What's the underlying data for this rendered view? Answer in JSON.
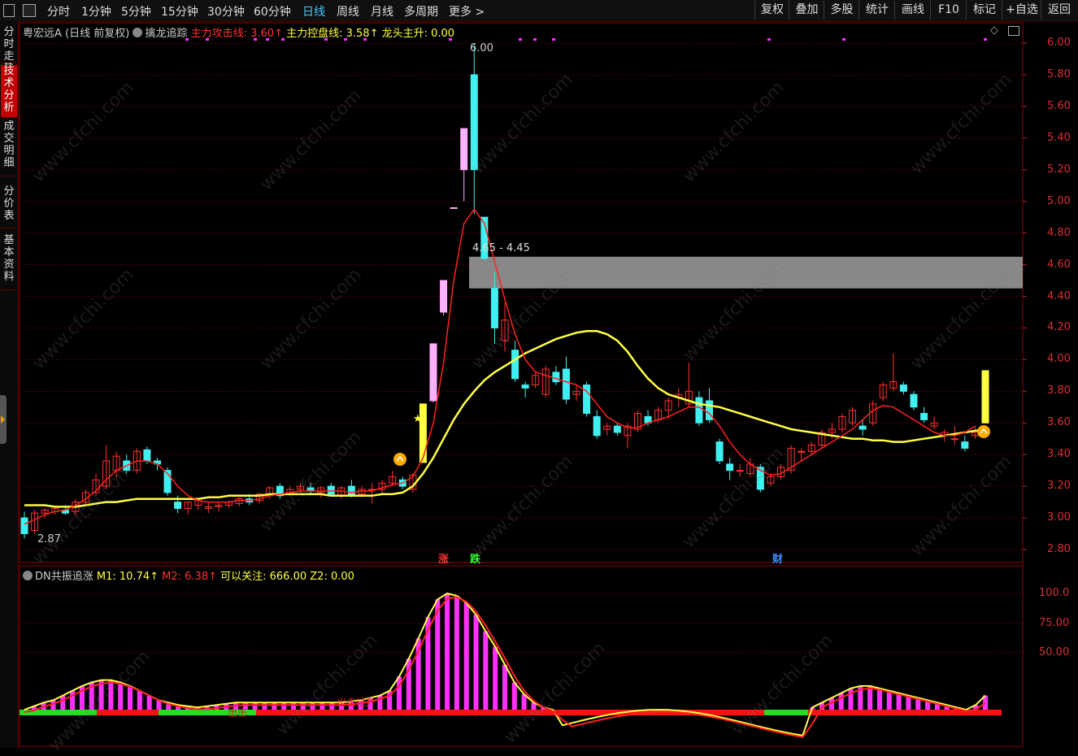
{
  "toolbar": {
    "periods": [
      "分时",
      "1分钟",
      "5分钟",
      "15分钟",
      "30分钟",
      "60分钟",
      "日线",
      "周线",
      "月线",
      "多周期",
      "更多 >"
    ],
    "active_period": "日线",
    "right_buttons": [
      "复权",
      "叠加",
      "多股",
      "统计",
      "画线",
      "F10",
      "标记",
      "+自选",
      "返回"
    ]
  },
  "side_tabs": [
    "分时走势",
    "技术分析",
    "成交明细",
    "分价表",
    "基本资料"
  ],
  "active_side_tab": "技术分析",
  "main_header": {
    "stock": "粤宏远A",
    "mode": "(日线 前复权)",
    "indicator": "擒龙追踪",
    "l1": "主力攻击线: 3.60↑",
    "l2": "主力控盘线: 3.58↑",
    "l3": "龙头主升: 0.00"
  },
  "sub_header": {
    "indicator": "DN共振追涨",
    "m1": "M1: 10.74↑",
    "m2": "M2: 6.38↑",
    "focus": "可以关注: 666.00",
    "z2": "Z2: 0.00"
  },
  "price_axis": [
    "6.00",
    "5.80",
    "5.60",
    "5.40",
    "5.20",
    "5.00",
    "4.80",
    "4.60",
    "4.40",
    "4.20",
    "4.00",
    "3.80",
    "3.60",
    "3.40",
    "3.20",
    "3.00",
    "2.80"
  ],
  "sub_axis": [
    "100.0",
    "75.00",
    "50.00"
  ],
  "annotations": {
    "high": "6.00",
    "low": "2.87",
    "gap": "4.65 - 4.45",
    "tag_up": "涨",
    "tag_down": "跌",
    "tag_fin": "财",
    "sub_text1": "出击",
    "sub_text2": "出击拉升"
  },
  "watermark": "www.cfchi.com",
  "colors": {
    "up": "#ff3030",
    "down": "#40f0f0",
    "axis": "#d83030",
    "ma_yellow": "#ffff40",
    "pink": "#ff30ff",
    "gap_box": "#a0a0a0"
  },
  "chart_data": {
    "type": "candlestick",
    "ylim": [
      2.78,
      6.04
    ],
    "candles": [
      {
        "o": 3.0,
        "h": 3.04,
        "l": 2.87,
        "c": 2.9
      },
      {
        "o": 2.92,
        "h": 3.05,
        "l": 2.9,
        "c": 3.03
      },
      {
        "o": 3.03,
        "h": 3.06,
        "l": 3.0,
        "c": 3.05
      },
      {
        "o": 3.04,
        "h": 3.07,
        "l": 3.02,
        "c": 3.06
      },
      {
        "o": 3.05,
        "h": 3.08,
        "l": 3.02,
        "c": 3.03
      },
      {
        "o": 3.04,
        "h": 3.12,
        "l": 3.02,
        "c": 3.1
      },
      {
        "o": 3.1,
        "h": 3.18,
        "l": 3.08,
        "c": 3.16
      },
      {
        "o": 3.16,
        "h": 3.28,
        "l": 3.14,
        "c": 3.24
      },
      {
        "o": 3.2,
        "h": 3.46,
        "l": 3.18,
        "c": 3.36
      },
      {
        "o": 3.3,
        "h": 3.42,
        "l": 3.25,
        "c": 3.39
      },
      {
        "o": 3.36,
        "h": 3.4,
        "l": 3.28,
        "c": 3.3
      },
      {
        "o": 3.3,
        "h": 3.44,
        "l": 3.28,
        "c": 3.42
      },
      {
        "o": 3.43,
        "h": 3.45,
        "l": 3.34,
        "c": 3.36
      },
      {
        "o": 3.36,
        "h": 3.38,
        "l": 3.3,
        "c": 3.34
      },
      {
        "o": 3.3,
        "h": 3.32,
        "l": 3.14,
        "c": 3.16
      },
      {
        "o": 3.1,
        "h": 3.14,
        "l": 3.03,
        "c": 3.06
      },
      {
        "o": 3.06,
        "h": 3.1,
        "l": 3.02,
        "c": 3.1
      },
      {
        "o": 3.08,
        "h": 3.12,
        "l": 3.05,
        "c": 3.11
      },
      {
        "o": 3.06,
        "h": 3.1,
        "l": 3.03,
        "c": 3.07
      },
      {
        "o": 3.07,
        "h": 3.1,
        "l": 3.04,
        "c": 3.08
      },
      {
        "o": 3.08,
        "h": 3.11,
        "l": 3.06,
        "c": 3.1
      },
      {
        "o": 3.09,
        "h": 3.13,
        "l": 3.07,
        "c": 3.12
      },
      {
        "o": 3.12,
        "h": 3.15,
        "l": 3.08,
        "c": 3.1
      },
      {
        "o": 3.11,
        "h": 3.16,
        "l": 3.09,
        "c": 3.15
      },
      {
        "o": 3.14,
        "h": 3.2,
        "l": 3.12,
        "c": 3.19
      },
      {
        "o": 3.2,
        "h": 3.22,
        "l": 3.12,
        "c": 3.14
      },
      {
        "o": 3.16,
        "h": 3.2,
        "l": 3.14,
        "c": 3.18
      },
      {
        "o": 3.18,
        "h": 3.22,
        "l": 3.16,
        "c": 3.2
      },
      {
        "o": 3.19,
        "h": 3.22,
        "l": 3.15,
        "c": 3.17
      },
      {
        "o": 3.16,
        "h": 3.2,
        "l": 3.13,
        "c": 3.19
      },
      {
        "o": 3.2,
        "h": 3.22,
        "l": 3.14,
        "c": 3.15
      },
      {
        "o": 3.14,
        "h": 3.2,
        "l": 3.12,
        "c": 3.19
      },
      {
        "o": 3.2,
        "h": 3.24,
        "l": 3.13,
        "c": 3.14
      },
      {
        "o": 3.15,
        "h": 3.2,
        "l": 3.13,
        "c": 3.18
      },
      {
        "o": 3.18,
        "h": 3.22,
        "l": 3.09,
        "c": 3.18
      },
      {
        "o": 3.18,
        "h": 3.24,
        "l": 3.15,
        "c": 3.22
      },
      {
        "o": 3.22,
        "h": 3.3,
        "l": 3.2,
        "c": 3.26
      },
      {
        "o": 3.24,
        "h": 3.26,
        "l": 3.18,
        "c": 3.2
      },
      {
        "o": 3.18,
        "h": 3.28,
        "l": 3.16,
        "c": 3.27
      },
      {
        "o": 3.35,
        "h": 3.72,
        "l": 3.35,
        "c": 3.72
      },
      {
        "o": 3.74,
        "h": 4.1,
        "l": 3.73,
        "c": 4.1
      },
      {
        "o": 4.3,
        "h": 4.5,
        "l": 4.28,
        "c": 4.5
      },
      {
        "o": 4.96,
        "h": 4.96,
        "l": 4.96,
        "c": 4.96
      },
      {
        "o": 5.2,
        "h": 5.46,
        "l": 5.0,
        "c": 5.46
      },
      {
        "o": 5.8,
        "h": 6.0,
        "l": 4.92,
        "c": 5.2
      },
      {
        "o": 4.9,
        "h": 4.9,
        "l": 4.63,
        "c": 4.64
      },
      {
        "o": 4.45,
        "h": 4.55,
        "l": 4.1,
        "c": 4.2
      },
      {
        "o": 4.12,
        "h": 4.36,
        "l": 4.05,
        "c": 4.25
      },
      {
        "o": 4.06,
        "h": 4.12,
        "l": 3.86,
        "c": 3.88
      },
      {
        "o": 3.84,
        "h": 3.86,
        "l": 3.76,
        "c": 3.82
      },
      {
        "o": 3.84,
        "h": 3.92,
        "l": 3.82,
        "c": 3.9
      },
      {
        "o": 3.78,
        "h": 3.96,
        "l": 3.76,
        "c": 3.94
      },
      {
        "o": 3.92,
        "h": 3.96,
        "l": 3.84,
        "c": 3.86
      },
      {
        "o": 3.94,
        "h": 4.02,
        "l": 3.72,
        "c": 3.75
      },
      {
        "o": 3.78,
        "h": 3.84,
        "l": 3.74,
        "c": 3.8
      },
      {
        "o": 3.84,
        "h": 3.86,
        "l": 3.64,
        "c": 3.66
      },
      {
        "o": 3.64,
        "h": 3.68,
        "l": 3.5,
        "c": 3.52
      },
      {
        "o": 3.56,
        "h": 3.6,
        "l": 3.52,
        "c": 3.58
      },
      {
        "o": 3.58,
        "h": 3.6,
        "l": 3.52,
        "c": 3.54
      },
      {
        "o": 3.52,
        "h": 3.6,
        "l": 3.44,
        "c": 3.58
      },
      {
        "o": 3.56,
        "h": 3.68,
        "l": 3.54,
        "c": 3.66
      },
      {
        "o": 3.64,
        "h": 3.68,
        "l": 3.58,
        "c": 3.6
      },
      {
        "o": 3.62,
        "h": 3.7,
        "l": 3.6,
        "c": 3.68
      },
      {
        "o": 3.68,
        "h": 3.76,
        "l": 3.62,
        "c": 3.74
      },
      {
        "o": 3.76,
        "h": 3.82,
        "l": 3.7,
        "c": 3.78
      },
      {
        "o": 3.72,
        "h": 3.98,
        "l": 3.7,
        "c": 3.8
      },
      {
        "o": 3.76,
        "h": 3.8,
        "l": 3.58,
        "c": 3.6
      },
      {
        "o": 3.74,
        "h": 3.82,
        "l": 3.6,
        "c": 3.62
      },
      {
        "o": 3.48,
        "h": 3.5,
        "l": 3.34,
        "c": 3.36
      },
      {
        "o": 3.34,
        "h": 3.38,
        "l": 3.24,
        "c": 3.3
      },
      {
        "o": 3.3,
        "h": 3.34,
        "l": 3.26,
        "c": 3.3
      },
      {
        "o": 3.28,
        "h": 3.38,
        "l": 3.26,
        "c": 3.34
      },
      {
        "o": 3.32,
        "h": 3.34,
        "l": 3.16,
        "c": 3.18
      },
      {
        "o": 3.22,
        "h": 3.28,
        "l": 3.2,
        "c": 3.26
      },
      {
        "o": 3.26,
        "h": 3.34,
        "l": 3.24,
        "c": 3.32
      },
      {
        "o": 3.3,
        "h": 3.46,
        "l": 3.28,
        "c": 3.44
      },
      {
        "o": 3.42,
        "h": 3.44,
        "l": 3.36,
        "c": 3.42
      },
      {
        "o": 3.42,
        "h": 3.48,
        "l": 3.4,
        "c": 3.46
      },
      {
        "o": 3.46,
        "h": 3.56,
        "l": 3.44,
        "c": 3.54
      },
      {
        "o": 3.54,
        "h": 3.6,
        "l": 3.5,
        "c": 3.56
      },
      {
        "o": 3.56,
        "h": 3.66,
        "l": 3.54,
        "c": 3.64
      },
      {
        "o": 3.6,
        "h": 3.7,
        "l": 3.58,
        "c": 3.68
      },
      {
        "o": 3.58,
        "h": 3.62,
        "l": 3.52,
        "c": 3.56
      },
      {
        "o": 3.6,
        "h": 3.74,
        "l": 3.58,
        "c": 3.72
      },
      {
        "o": 3.76,
        "h": 3.86,
        "l": 3.74,
        "c": 3.84
      },
      {
        "o": 3.82,
        "h": 4.04,
        "l": 3.8,
        "c": 3.86
      },
      {
        "o": 3.84,
        "h": 3.86,
        "l": 3.78,
        "c": 3.8
      },
      {
        "o": 3.78,
        "h": 3.8,
        "l": 3.68,
        "c": 3.7
      },
      {
        "o": 3.66,
        "h": 3.7,
        "l": 3.6,
        "c": 3.62
      },
      {
        "o": 3.58,
        "h": 3.64,
        "l": 3.56,
        "c": 3.6
      },
      {
        "o": 3.52,
        "h": 3.56,
        "l": 3.48,
        "c": 3.54
      },
      {
        "o": 3.5,
        "h": 3.58,
        "l": 3.46,
        "c": 3.5
      },
      {
        "o": 3.48,
        "h": 3.52,
        "l": 3.42,
        "c": 3.44
      },
      {
        "o": 3.52,
        "h": 3.58,
        "l": 3.5,
        "c": 3.54
      },
      {
        "o": 3.6,
        "h": 3.93,
        "l": 3.6,
        "c": 3.93
      }
    ],
    "yellow_line": [
      3.08,
      3.08,
      3.08,
      3.07,
      3.07,
      3.07,
      3.08,
      3.09,
      3.1,
      3.1,
      3.11,
      3.12,
      3.12,
      3.12,
      3.12,
      3.12,
      3.12,
      3.12,
      3.13,
      3.13,
      3.14,
      3.14,
      3.14,
      3.14,
      3.15,
      3.15,
      3.15,
      3.15,
      3.15,
      3.15,
      3.14,
      3.14,
      3.14,
      3.14,
      3.14,
      3.15,
      3.15,
      3.16,
      3.2,
      3.28,
      3.38,
      3.5,
      3.62,
      3.72,
      3.8,
      3.87,
      3.92,
      3.96,
      4.0,
      4.04,
      4.07,
      4.1,
      4.13,
      4.15,
      4.17,
      4.18,
      4.18,
      4.16,
      4.12,
      4.05,
      3.96,
      3.88,
      3.82,
      3.78,
      3.76,
      3.74,
      3.72,
      3.71,
      3.7,
      3.68,
      3.66,
      3.64,
      3.62,
      3.6,
      3.58,
      3.56,
      3.55,
      3.54,
      3.53,
      3.52,
      3.51,
      3.5,
      3.5,
      3.49,
      3.49,
      3.48,
      3.48,
      3.49,
      3.5,
      3.51,
      3.52,
      3.53,
      3.54,
      3.55,
      3.56
    ],
    "red_line": [
      2.96,
      2.99,
      3.02,
      3.04,
      3.05,
      3.08,
      3.12,
      3.17,
      3.24,
      3.3,
      3.33,
      3.36,
      3.36,
      3.34,
      3.28,
      3.2,
      3.14,
      3.11,
      3.1,
      3.1,
      3.1,
      3.11,
      3.11,
      3.12,
      3.14,
      3.15,
      3.16,
      3.17,
      3.17,
      3.17,
      3.17,
      3.17,
      3.16,
      3.17,
      3.17,
      3.19,
      3.21,
      3.22,
      3.26,
      3.38,
      3.6,
      3.98,
      4.5,
      4.86,
      4.95,
      4.86,
      4.62,
      4.38,
      4.16,
      4.0,
      3.92,
      3.9,
      3.88,
      3.86,
      3.84,
      3.8,
      3.72,
      3.64,
      3.6,
      3.57,
      3.57,
      3.6,
      3.62,
      3.64,
      3.67,
      3.7,
      3.7,
      3.66,
      3.58,
      3.48,
      3.4,
      3.34,
      3.3,
      3.27,
      3.28,
      3.32,
      3.36,
      3.4,
      3.44,
      3.48,
      3.52,
      3.56,
      3.62,
      3.68,
      3.71,
      3.7,
      3.66,
      3.62,
      3.58,
      3.54,
      3.52,
      3.52,
      3.54,
      3.58
    ],
    "gap_box": [
      4.45,
      4.65
    ],
    "oscillator": {
      "ylim": [
        -30,
        105
      ],
      "bars": [
        2,
        5,
        8,
        10,
        14,
        18,
        22,
        25,
        27,
        27,
        25,
        22,
        18,
        14,
        10,
        8,
        6,
        5,
        4,
        5,
        6,
        7,
        8,
        8,
        8,
        8,
        8,
        8,
        8,
        8,
        8,
        8,
        8,
        8,
        9,
        10,
        12,
        14,
        18,
        30,
        45,
        62,
        80,
        95,
        100,
        98,
        92,
        82,
        68,
        55,
        40,
        25,
        15,
        8,
        4,
        2,
        0,
        0,
        0,
        0,
        0,
        0,
        0,
        0,
        0,
        0,
        0,
        0,
        0,
        0,
        0,
        0,
        0,
        0,
        0,
        0,
        0,
        0,
        0,
        0,
        0,
        0,
        4,
        8,
        12,
        16,
        20,
        22,
        22,
        20,
        18,
        16,
        14,
        12,
        10,
        8,
        6,
        4,
        2,
        6,
        14
      ]
    }
  }
}
